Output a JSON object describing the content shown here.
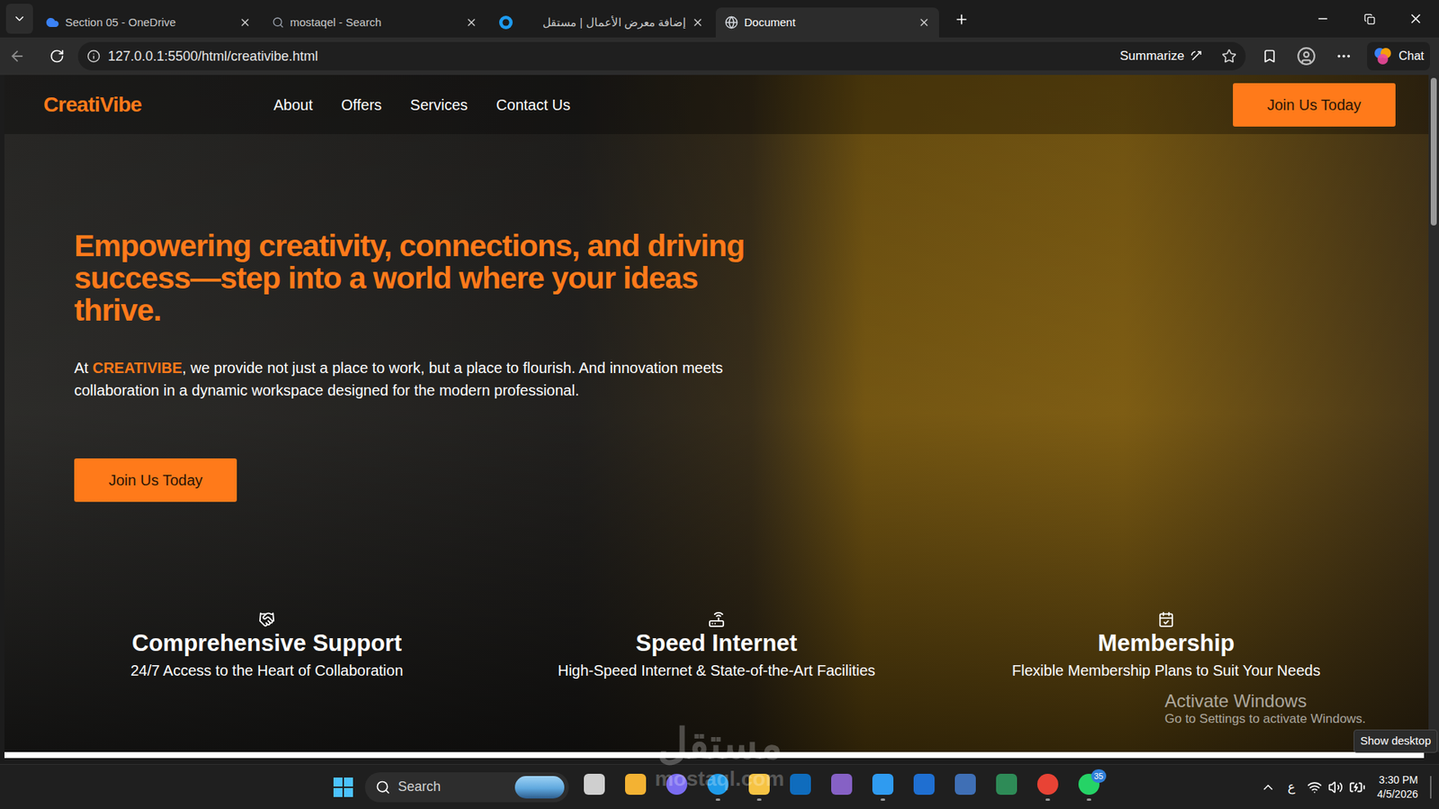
{
  "browser": {
    "tabs": [
      {
        "label": "Section 05 - OneDrive",
        "selected": false
      },
      {
        "label": "mostaqel - Search",
        "selected": false
      },
      {
        "label": "إضافة معرض الأعمال | مستقل",
        "selected": false
      },
      {
        "label": "Document",
        "selected": true
      }
    ],
    "address": {
      "url": "127.0.0.1:5500/html/creativibe.html",
      "summarize": "Summarize",
      "chat": "Chat"
    }
  },
  "site": {
    "logo": "CreatiVibe",
    "nav": [
      "About",
      "Offers",
      "Services",
      "Contact Us"
    ],
    "header_button": "Join Us Today",
    "hero": {
      "heading": "Empowering creativity, connections, and driving success—step into a world where your ideas thrive.",
      "intro_before": "At ",
      "brand": "CREATIVIBE",
      "intro_after": ", we provide not just a place to work, but a place to flourish. And innovation meets collaboration in a dynamic workspace designed for the modern professional.",
      "button": "Join Us Today"
    },
    "features": [
      {
        "title": "Comprehensive Support",
        "text": "24/7 Access to the Heart of Collaboration"
      },
      {
        "title": "Speed Internet",
        "text": "High-Speed Internet & State-of-the-Art Facilities"
      },
      {
        "title": "Membership",
        "text": "Flexible Membership Plans to Suit Your Needs"
      }
    ],
    "scroll": {
      "position": 0,
      "visible_share": 0.22
    }
  },
  "overlays": {
    "activation_title": "Activate Windows",
    "activation_text": "Go to Settings to activate Windows.",
    "tooltip": "Show desktop",
    "watermark_ar": "مستقل",
    "watermark_url": "mostaql.com"
  },
  "taskbar": {
    "search": "Search",
    "apps": [
      {
        "color": "#cfcfcf",
        "running": false
      },
      {
        "color": "#f3b233",
        "running": false
      },
      {
        "color": "#7a6cf0",
        "running": false
      },
      {
        "color": "#1e9be9",
        "running": true
      },
      {
        "color": "#f6c343",
        "running": true
      },
      {
        "color": "#0f6cbd",
        "running": false
      },
      {
        "color": "#8661c5",
        "running": false
      },
      {
        "color": "#2f9bf0",
        "running": true
      },
      {
        "color": "#1f6fd1",
        "running": false
      },
      {
        "color": "#3f6fb5",
        "running": false
      },
      {
        "color": "#2e8b57",
        "running": false
      },
      {
        "color": "#e84335",
        "running": true
      },
      {
        "color": "#25d366",
        "running": true,
        "badge": "35"
      }
    ],
    "tray": {
      "language": "ع",
      "time": "3:30 PM",
      "date": "4/5/2026"
    }
  }
}
